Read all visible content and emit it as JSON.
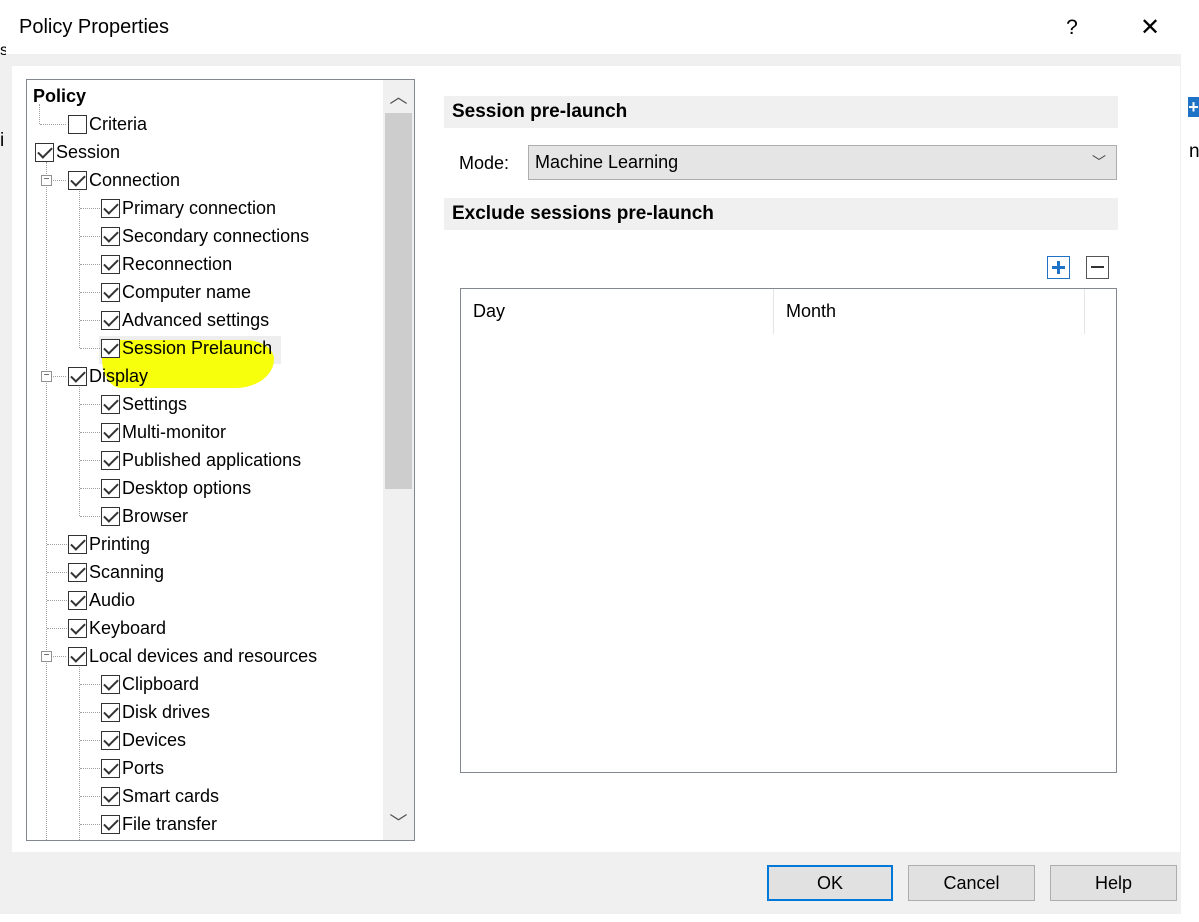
{
  "window": {
    "title": "Policy Properties",
    "help": "?",
    "close": "✕"
  },
  "tree": {
    "items": [
      {
        "label": "Policy",
        "bold": true,
        "checkbox": false
      },
      {
        "label": "Criteria",
        "checked": false
      },
      {
        "label": "Session",
        "checked": true
      },
      {
        "label": "Connection",
        "checked": true,
        "expander": "⊟"
      },
      {
        "label": "Primary connection",
        "checked": true
      },
      {
        "label": "Secondary connections",
        "checked": true
      },
      {
        "label": "Reconnection",
        "checked": true
      },
      {
        "label": "Computer name",
        "checked": true
      },
      {
        "label": "Advanced settings",
        "checked": true
      },
      {
        "label": "Session Prelaunch",
        "checked": true,
        "selected": true
      },
      {
        "label": "Display",
        "checked": true,
        "expander": "⊟"
      },
      {
        "label": "Settings",
        "checked": true
      },
      {
        "label": "Multi-monitor",
        "checked": true
      },
      {
        "label": "Published applications",
        "checked": true
      },
      {
        "label": "Desktop options",
        "checked": true
      },
      {
        "label": "Browser",
        "checked": true
      },
      {
        "label": "Printing",
        "checked": true
      },
      {
        "label": "Scanning",
        "checked": true
      },
      {
        "label": "Audio",
        "checked": true
      },
      {
        "label": "Keyboard",
        "checked": true
      },
      {
        "label": "Local devices and resources",
        "checked": true,
        "expander": "⊟"
      },
      {
        "label": "Clipboard",
        "checked": true
      },
      {
        "label": "Disk drives",
        "checked": true
      },
      {
        "label": "Devices",
        "checked": true
      },
      {
        "label": "Ports",
        "checked": true
      },
      {
        "label": "Smart cards",
        "checked": true
      },
      {
        "label": "File transfer",
        "checked": true
      }
    ]
  },
  "prelaunch": {
    "heading": "Session pre-launch",
    "mode_label": "Mode:",
    "mode_value": "Machine Learning"
  },
  "exclude": {
    "heading": "Exclude sessions pre-launch",
    "columns": [
      "Day",
      "Month"
    ]
  },
  "buttons": {
    "ok": "OK",
    "cancel": "Cancel",
    "help": "Help"
  },
  "colors": {
    "highlight_marker": "#f7ff00",
    "accent": "#0078d7"
  }
}
